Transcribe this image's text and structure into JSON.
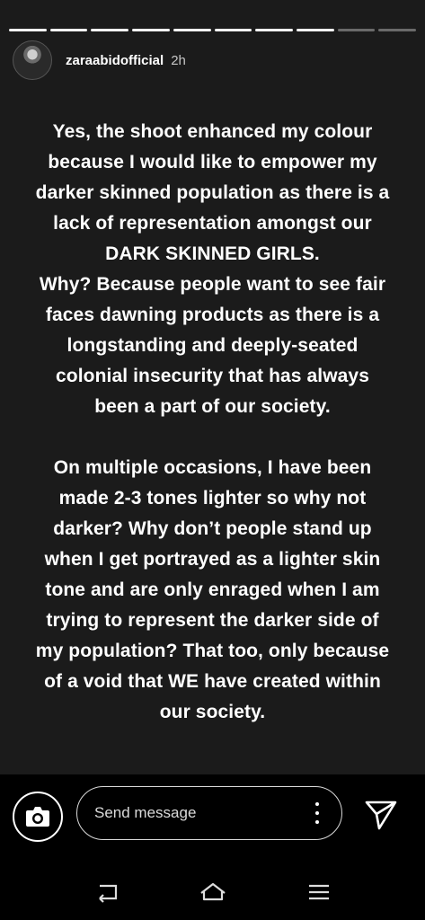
{
  "story": {
    "progress_segments": 10,
    "progress_done": 8,
    "username": "zaraabidofficial",
    "time": "2h",
    "paragraphs": [
      [
        "Yes, the shoot enhanced my colour",
        "because I would like to empower my",
        "darker skinned population as there is a",
        "lack of representation amongst our",
        "DARK SKINNED GIRLS.",
        "Why? Because people want to see fair",
        "faces dawning products as there is a",
        "longstanding and deeply-seated",
        "colonial insecurity that has always",
        "been a part of our society."
      ],
      [
        "On multiple occasions, I have been",
        "made 2-3 tones lighter so why not",
        "darker? Why don’t people stand up",
        "when I get portrayed as a lighter skin",
        "tone and are only enraged when I am",
        "trying to represent the darker side of",
        "my population? That too, only because",
        "of a void that WE have created within",
        "our society."
      ]
    ]
  },
  "footer": {
    "message_placeholder": "Send message"
  },
  "icons": {
    "camera": "camera-icon",
    "more": "more-vertical-icon",
    "send": "send-icon",
    "back": "back-icon",
    "home": "home-icon",
    "recents": "recents-icon"
  },
  "colors": {
    "story_background": "#1b1b1b",
    "text": "#ffffff"
  }
}
